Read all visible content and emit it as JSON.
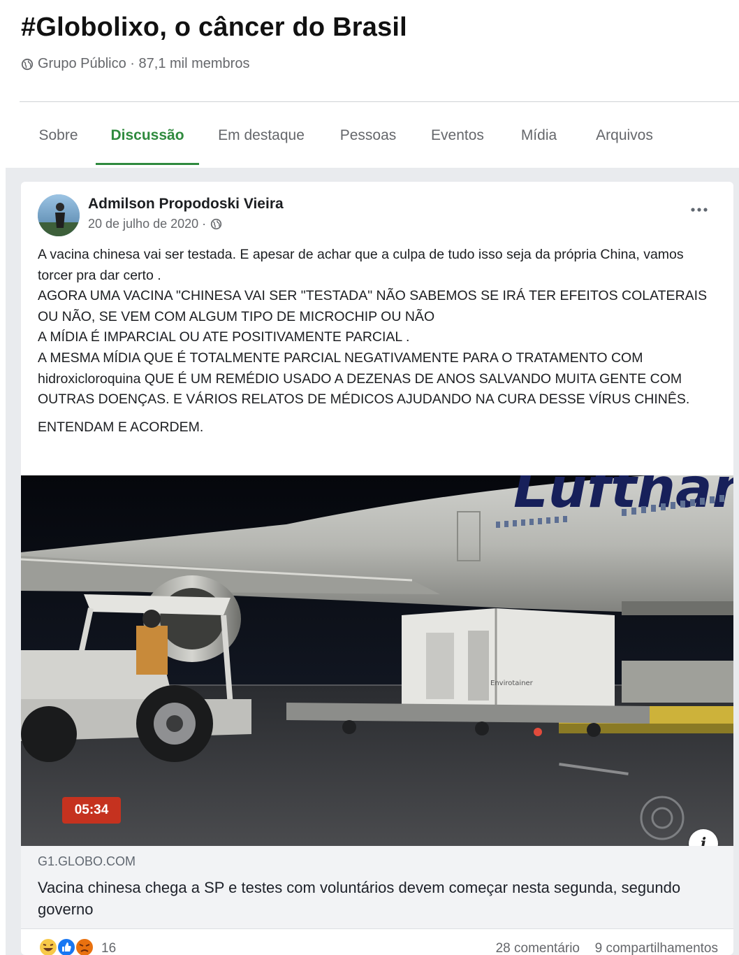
{
  "group": {
    "title": "#Globolixo, o câncer do Brasil",
    "meta": "Grupo Público · 87,1 mil membros"
  },
  "tabs": [
    {
      "label": "Sobre",
      "active": false
    },
    {
      "label": "Discussão",
      "active": true
    },
    {
      "label": "Em destaque",
      "active": false
    },
    {
      "label": "Pessoas",
      "active": false
    },
    {
      "label": "Eventos",
      "active": false
    },
    {
      "label": "Mídia",
      "active": false
    },
    {
      "label": "Arquivos",
      "active": false
    }
  ],
  "post": {
    "author": "Admilson Propodoski Vieira",
    "date": "20 de julho de 2020 ·",
    "paragraphs": [
      "A vacina chinesa vai ser testada. E apesar de achar que a culpa de tudo isso seja da própria China, vamos torcer pra dar certo .\nAGORA UMA VACINA \"CHINESA VAI SER \"TESTADA\" NÃO SABEMOS SE IRÁ TER EFEITOS COLATERAIS OU NÃO,  SE VEM COM ALGUM TIPO DE MICROCHIP OU NÃO\n A MÍDIA É IMPARCIAL OU ATE POSITIVAMENTE PARCIAL .\nA MESMA MÍDIA QUE É TOTALMENTE PARCIAL NEGATIVAMENTE PARA O TRATAMENTO COM hidroxicloroquina QUE É UM REMÉDIO USADO A DEZENAS  DE ANOS SALVANDO MUITA GENTE COM OUTRAS DOENÇAS.  E VÁRIOS  RELATOS DE MÉDICOS AJUDANDO NA CURA DESSE VÍRUS CHINÊS.",
      "ENTENDAM E ACORDEM."
    ],
    "video": {
      "duration": "05:34",
      "fuselage_text": "Lufthansa",
      "container_text": "Envirotainer"
    },
    "link": {
      "domain": "G1.GLOBO.COM",
      "title": "Vacina chinesa chega a SP e testes com voluntários devem começar nesta segunda, segundo governo"
    },
    "reactions": {
      "count": "16",
      "comments": "28 comentário",
      "shares": "9 compartilhamentos"
    }
  },
  "colors": {
    "accent": "#2f8a3e",
    "duration_badge": "#c5321f",
    "feed_background": "#e9ebee"
  }
}
